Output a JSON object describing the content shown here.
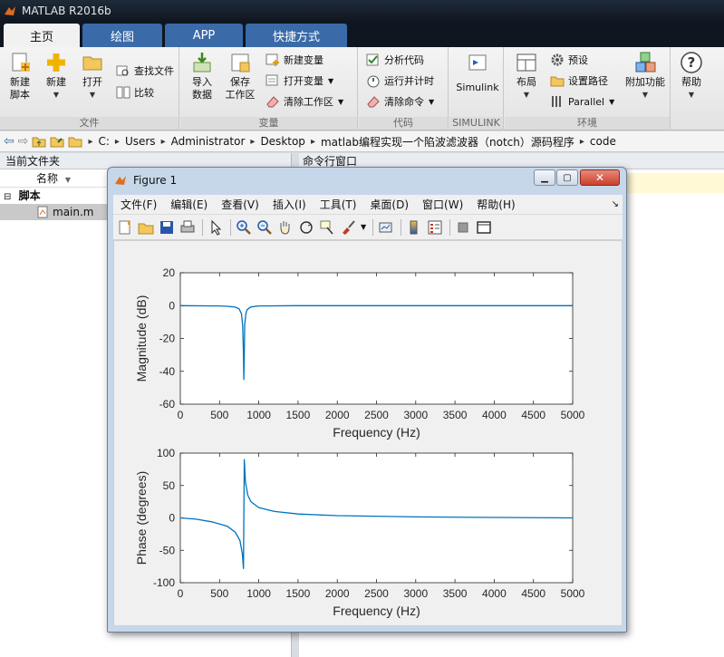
{
  "app": {
    "title": "MATLAB R2016b"
  },
  "tabs": [
    {
      "label": "主页",
      "active": true
    },
    {
      "label": "绘图"
    },
    {
      "label": "APP"
    },
    {
      "label": "快捷方式"
    }
  ],
  "ribbon": {
    "file_group": {
      "label": "文件",
      "new_script": "新建\n脚本",
      "new": "新建",
      "open": "打开",
      "find_files": "查找文件",
      "compare": "比较"
    },
    "variable_group": {
      "label": "变量",
      "import_data": "导入\n数据",
      "save_workspace": "保存\n工作区",
      "new_variable": "新建变量",
      "open_variable": "打开变量",
      "clear_workspace": "清除工作区"
    },
    "code_group": {
      "label": "代码",
      "analyze_code": "分析代码",
      "run_and_time": "运行并计时",
      "clear_commands": "清除命令"
    },
    "simulink_group": {
      "label": "SIMULINK",
      "simulink": "Simulink"
    },
    "environment_group": {
      "label": "环境",
      "layout": "布局",
      "preferences": "预设",
      "set_path": "设置路径",
      "parallel": "Parallel",
      "addons": "附加功能"
    },
    "help": "帮助"
  },
  "address": {
    "path": [
      "C:",
      "Users",
      "Administrator",
      "Desktop",
      "matlab编程实现一个陷波滤波器（notch）源码程序",
      "code"
    ]
  },
  "current_folder": {
    "title": "当前文件夹",
    "col_name": "名称",
    "group": "脚本",
    "file": "main.m"
  },
  "command_window": {
    "title": "命令行窗口"
  },
  "figure": {
    "title": "Figure 1",
    "menus": [
      "文件(F)",
      "编辑(E)",
      "查看(V)",
      "插入(I)",
      "工具(T)",
      "桌面(D)",
      "窗口(W)",
      "帮助(H)"
    ]
  },
  "colors": {
    "plot_line": "#0072bd",
    "ribbon_tab": "#3a6aa8",
    "title_bar": "#1f2b3a"
  },
  "chart_data": [
    {
      "type": "line",
      "title": "",
      "xlabel": "Frequency (Hz)",
      "ylabel": "Magnitude (dB)",
      "xlim": [
        0,
        5000
      ],
      "ylim": [
        -60,
        20
      ],
      "xticks": [
        0,
        500,
        1000,
        1500,
        2000,
        2500,
        3000,
        3500,
        4000,
        4500,
        5000
      ],
      "yticks": [
        -60,
        -40,
        -20,
        0,
        20
      ],
      "grid": false,
      "series": [
        {
          "x": [
            0,
            500,
            600,
            700,
            750,
            780,
            795,
            805,
            810,
            815,
            820,
            835,
            850,
            900,
            1000,
            1500,
            2000,
            3000,
            4000,
            5000
          ],
          "y": [
            0,
            -0.2,
            -0.4,
            -0.9,
            -2,
            -5,
            -12,
            -30,
            -45,
            -30,
            -12,
            -5,
            -2.5,
            -0.8,
            -0.2,
            0,
            0,
            0,
            0,
            0
          ]
        }
      ]
    },
    {
      "type": "line",
      "title": "",
      "xlabel": "Frequency (Hz)",
      "ylabel": "Phase (degrees)",
      "xlim": [
        0,
        5000
      ],
      "ylim": [
        -100,
        100
      ],
      "xticks": [
        0,
        500,
        1000,
        1500,
        2000,
        2500,
        3000,
        3500,
        4000,
        4500,
        5000
      ],
      "yticks": [
        -100,
        -50,
        0,
        50,
        100
      ],
      "grid": false,
      "series": [
        {
          "x": [
            0,
            200,
            400,
            600,
            700,
            760,
            790,
            805,
            810,
            815,
            830,
            860,
            900,
            1000,
            1200,
            1500,
            2000,
            3000,
            4000,
            5000
          ],
          "y": [
            0,
            -2,
            -6,
            -13,
            -22,
            -35,
            -55,
            -78,
            0,
            90,
            55,
            35,
            25,
            16,
            10,
            6,
            3.5,
            1.5,
            0.7,
            0
          ]
        }
      ]
    }
  ]
}
